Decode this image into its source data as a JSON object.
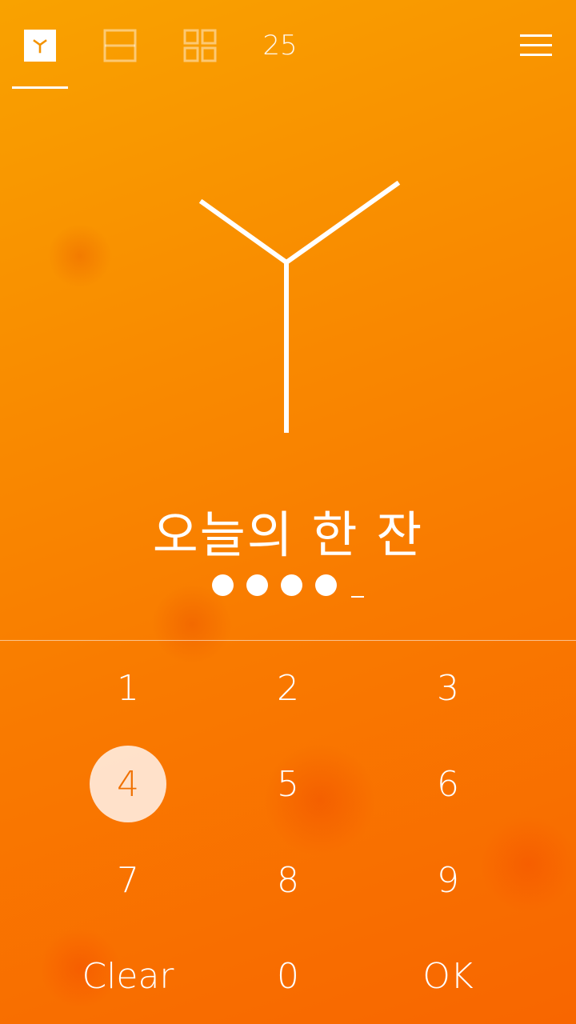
{
  "header": {
    "tabs": [
      {
        "icon": "logo-y-icon"
      },
      {
        "icon": "two-panel-icon"
      },
      {
        "icon": "grid-icon"
      },
      {
        "label": "25"
      }
    ],
    "active_tab": 0,
    "menu_icon": "hamburger-menu-icon"
  },
  "main": {
    "logo_icon": "y-logo-icon",
    "title": "오늘의 한 잔",
    "pin": {
      "entered_digits": 4
    }
  },
  "keypad": {
    "keys": [
      "1",
      "2",
      "3",
      "4",
      "5",
      "6",
      "7",
      "8",
      "9",
      "Clear",
      "0",
      "OK"
    ],
    "pressed_key": "4"
  },
  "colors": {
    "background_top": "#f9a200",
    "background_bottom": "#f86600",
    "pressed_key_text": "#f07000",
    "foreground": "#ffffff"
  }
}
